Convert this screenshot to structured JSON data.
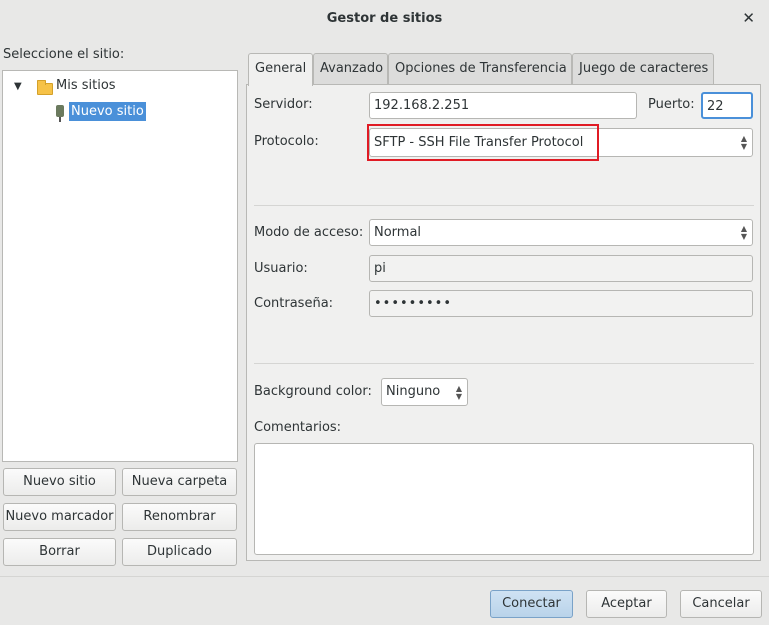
{
  "window": {
    "title": "Gestor de sitios"
  },
  "left": {
    "heading": "Seleccione el sitio:",
    "tree": {
      "root_label": "Mis sitios",
      "child_label": "Nuevo sitio"
    },
    "buttons": {
      "new_site": "Nuevo sitio",
      "new_folder": "Nueva carpeta",
      "new_bookmark": "Nuevo marcador",
      "rename": "Renombrar",
      "delete": "Borrar",
      "duplicate": "Duplicado"
    }
  },
  "tabs": [
    "General",
    "Avanzado",
    "Opciones de Transferencia",
    "Juego de caracteres"
  ],
  "general": {
    "server_label": "Servidor:",
    "server_value": "192.168.2.251",
    "port_label": "Puerto:",
    "port_value": "22",
    "protocol_label": "Protocolo:",
    "protocol_value": "SFTP - SSH File Transfer Protocol",
    "logon_label": "Modo de acceso:",
    "logon_value": "Normal",
    "user_label": "Usuario:",
    "user_value": "pi",
    "password_label": "Contraseña:",
    "password_value": "•••••••••",
    "bg_color_label": "Background color:",
    "bg_color_value": "Ninguno",
    "comments_label": "Comentarios:"
  },
  "footer": {
    "connect": "Conectar",
    "accept": "Aceptar",
    "cancel": "Cancelar"
  },
  "colors": {
    "selection": "#4a90d9",
    "highlight_box": "#e01b24"
  }
}
